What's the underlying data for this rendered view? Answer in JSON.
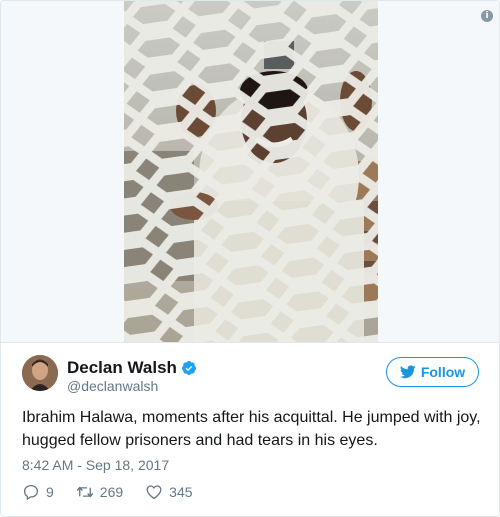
{
  "tweet": {
    "author_name": "Declan Walsh",
    "handle": "@declanwalsh",
    "follow_label": "Follow",
    "text": "Ibrahim Halawa, moments after his acquittal. He jumped with joy, hugged fellow prisoners and had tears in his eyes.",
    "timestamp": "8:42 AM - Sep 18, 2017",
    "replies": "9",
    "retweets": "269",
    "likes": "345"
  },
  "icons": {
    "info": "info-icon",
    "verified": "verified-badge-icon",
    "follow_bird": "twitter-bird-icon",
    "reply": "reply-icon",
    "retweet": "retweet-icon",
    "like": "heart-icon"
  },
  "colors": {
    "accent": "#1b95e0",
    "muted": "#657786",
    "text": "#14171a",
    "border": "#e1e8ed"
  }
}
